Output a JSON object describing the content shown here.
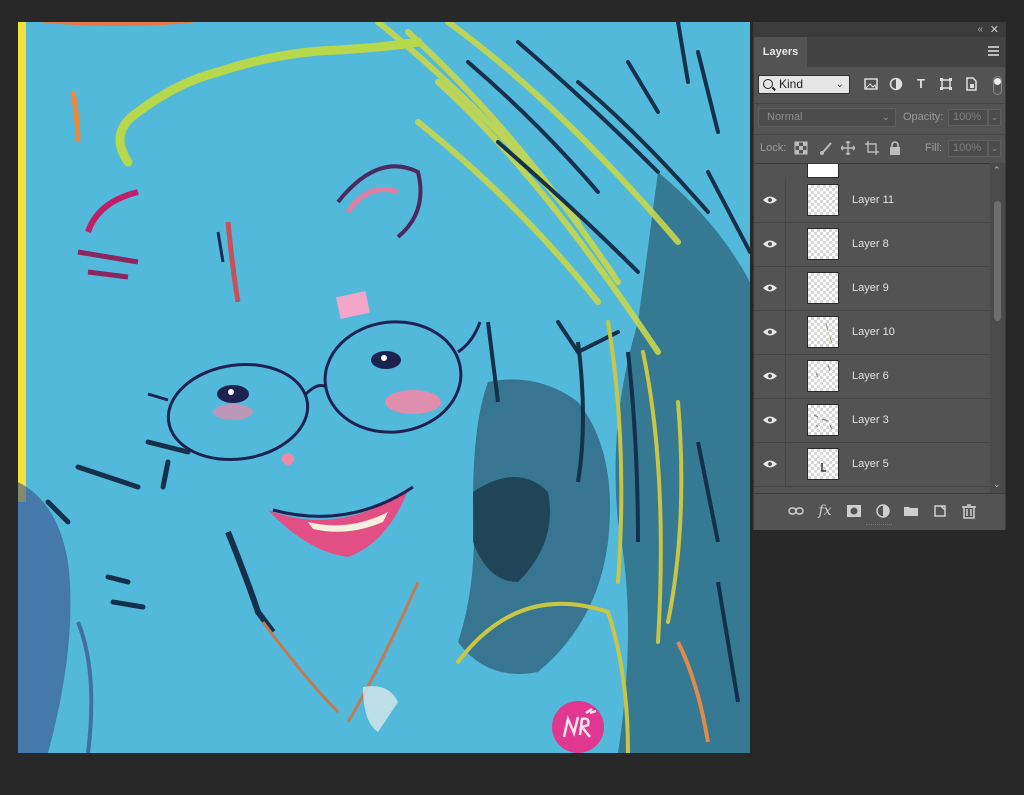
{
  "artwork": {
    "background_color": "#52b9db",
    "signature_badge_color": "#e0378f"
  },
  "panel": {
    "collapse_icon": "double-chevron-left-icon",
    "close_icon": "close-icon",
    "tab_label": "Layers",
    "filter": {
      "kind_label": "Kind",
      "icons": [
        "image-filter-icon",
        "adjustment-filter-icon",
        "type-filter-icon",
        "shape-filter-icon",
        "smart-object-filter-icon"
      ]
    },
    "blend_mode": "Normal",
    "opacity_label": "Opacity:",
    "opacity_value": "100%",
    "lock_label": "Lock:",
    "lock_icons": [
      "lock-transparent-icon",
      "lock-image-icon",
      "lock-position-icon",
      "lock-artboard-icon",
      "lock-all-icon"
    ],
    "fill_label": "Fill:",
    "fill_value": "100%",
    "layers": [
      {
        "name": "Layer 11",
        "visible": true
      },
      {
        "name": "Layer 8",
        "visible": true
      },
      {
        "name": "Layer 9",
        "visible": true
      },
      {
        "name": "Layer 10",
        "visible": true
      },
      {
        "name": "Layer 6",
        "visible": true
      },
      {
        "name": "Layer 3",
        "visible": true
      },
      {
        "name": "Layer 5",
        "visible": true
      }
    ],
    "footer_icons": [
      "link-layers-icon",
      "fx-icon",
      "add-mask-icon",
      "adjustment-layer-icon",
      "group-folder-icon",
      "new-layer-icon",
      "trash-icon"
    ],
    "fx_label": "fx"
  }
}
